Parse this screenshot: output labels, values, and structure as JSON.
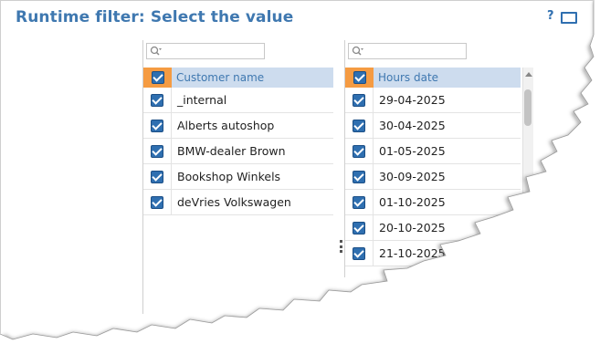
{
  "title": "Runtime filter: Select the value",
  "toolbar": {
    "help_label": "?"
  },
  "customer_panel": {
    "header": "Customer name",
    "items": [
      {
        "label": "_internal",
        "checked": true
      },
      {
        "label": "Alberts autoshop",
        "checked": true
      },
      {
        "label": "BMW-dealer Brown",
        "checked": true
      },
      {
        "label": "Bookshop Winkels",
        "checked": true
      },
      {
        "label": "deVries Volkswagen",
        "checked": true
      }
    ]
  },
  "hours_panel": {
    "header": "Hours date",
    "items": [
      {
        "label": "29-04-2025",
        "checked": true
      },
      {
        "label": "30-04-2025",
        "checked": true
      },
      {
        "label": "01-05-2025",
        "checked": true
      },
      {
        "label": "30-09-2025",
        "checked": true
      },
      {
        "label": "01-10-2025",
        "checked": true
      },
      {
        "label": "20-10-2025",
        "checked": true
      },
      {
        "label": "21-10-2025",
        "checked": true
      }
    ]
  },
  "colors": {
    "title": "#3f78b0",
    "header_bg": "#cddcee",
    "select_all_bg": "#f59b42",
    "checkbox": "#2f6fb0"
  }
}
